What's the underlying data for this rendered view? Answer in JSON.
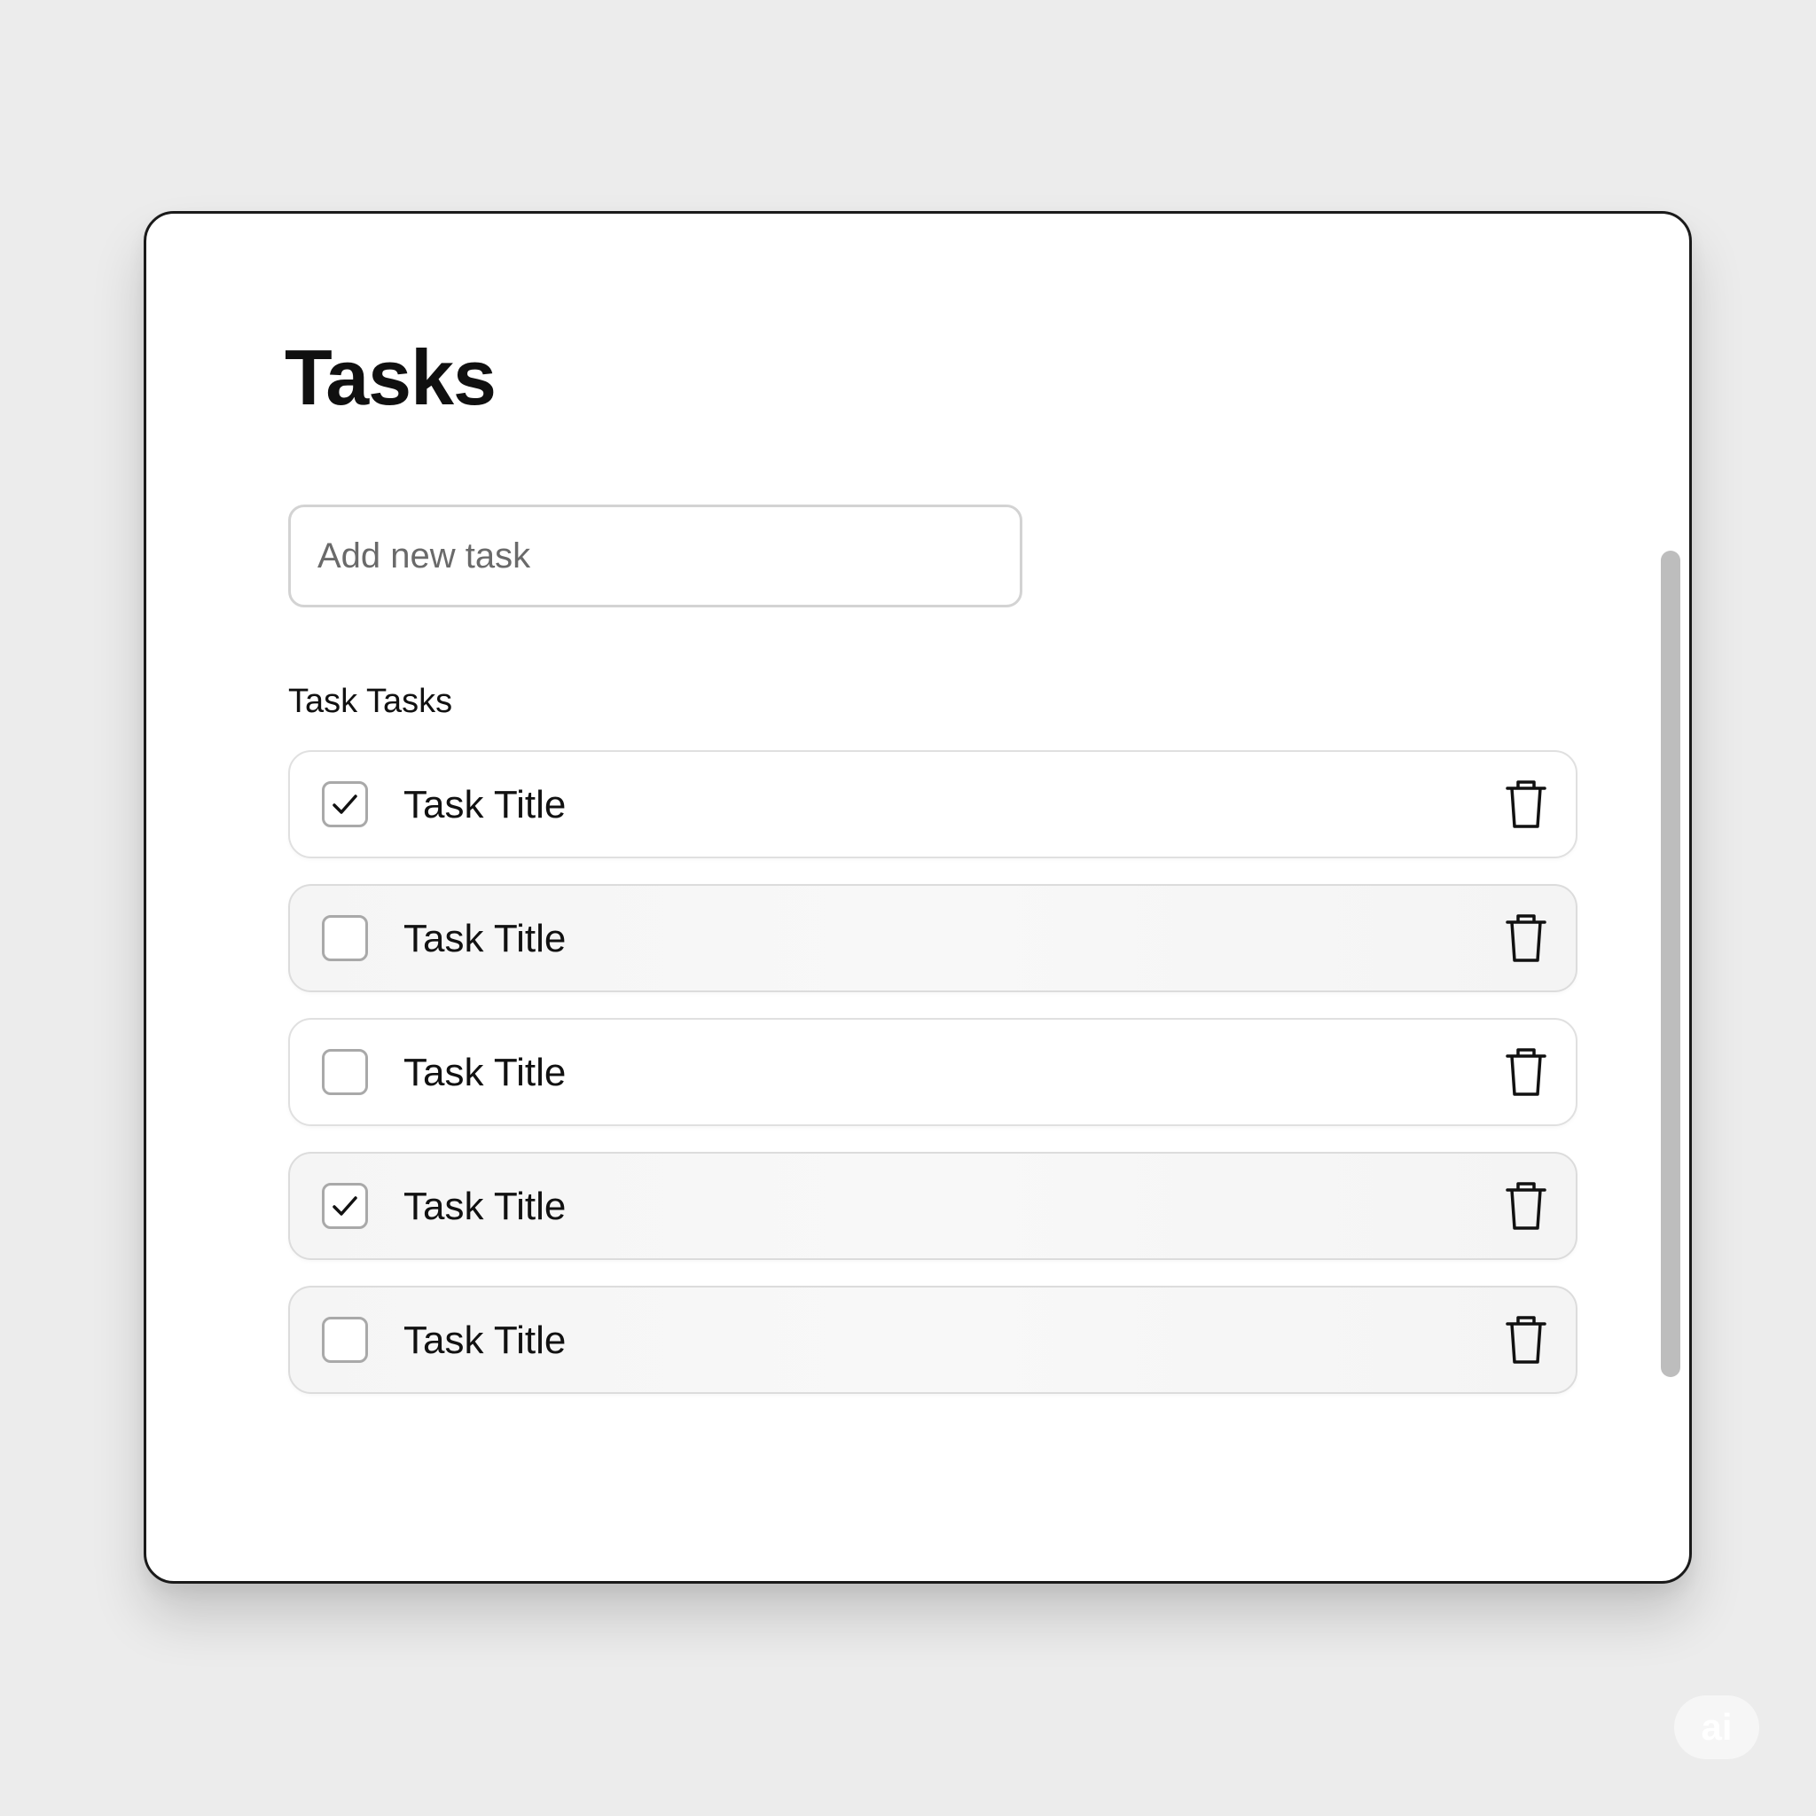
{
  "app": {
    "title": "Tasks"
  },
  "new_task": {
    "placeholder": "Add new task",
    "value": ""
  },
  "list": {
    "heading": "Task Tasks",
    "items": [
      {
        "title": "Task Title",
        "checked": true,
        "shaded": false
      },
      {
        "title": "Task Title",
        "checked": false,
        "shaded": true
      },
      {
        "title": "Task Title",
        "checked": false,
        "shaded": false
      },
      {
        "title": "Task Title",
        "checked": true,
        "shaded": true
      },
      {
        "title": "Task Title",
        "checked": false,
        "shaded": true
      }
    ]
  },
  "icons": {
    "checkbox_checked": "check-icon",
    "delete": "trash-icon"
  },
  "badge": {
    "label": "ai"
  },
  "colors": {
    "background": "#ececec",
    "window": "#ffffff",
    "border": "#1a1a1a",
    "scrollbar": "#bdbdbd"
  }
}
